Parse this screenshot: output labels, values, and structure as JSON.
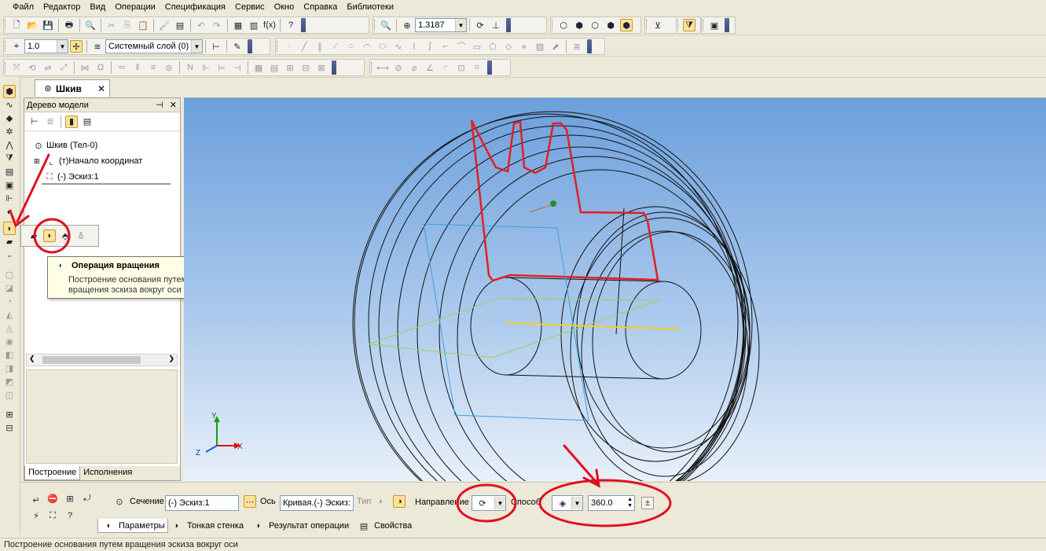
{
  "menu": [
    "Файл",
    "Редактор",
    "Вид",
    "Операции",
    "Спецификация",
    "Сервис",
    "Окно",
    "Справка",
    "Библиотеки"
  ],
  "toolbar": {
    "zoom_value": "1.3187",
    "line_width": "1.0",
    "layer": "Системный слой (0)"
  },
  "document_tab": {
    "title": "Шкив"
  },
  "tree": {
    "title": "Дерево модели",
    "root": "Шкив (Тел-0)",
    "items": [
      "(т)Начало координат",
      "(-) Эскиз:1"
    ],
    "tabs": [
      "Построение",
      "Исполнения"
    ]
  },
  "tooltip": {
    "title": "Операция вращения",
    "description": "Построение основания путем вращения эскиза вокруг оси"
  },
  "props": {
    "section_label": "Сечение",
    "section_value": "(-) Эскиз:1",
    "axis_label": "Ось",
    "axis_value": "Кривая.(-) Эскиз:",
    "type_label": "Тип",
    "direction_label": "Направление",
    "method_label": "Способ",
    "angle_value": "360.0",
    "tabs": [
      "Параметры",
      "Тонкая стенка",
      "Результат операции",
      "Свойства"
    ]
  },
  "axes": {
    "x": "X",
    "y": "Y",
    "z": "Z"
  },
  "status_text": "Построение основания путем вращения эскиза вокруг оси",
  "colors": {
    "viewport_top": "#6c9fdc",
    "sketch": "#e02020",
    "annotation": "#e01020",
    "axis_x": "#e01010",
    "axis_y": "#10a010",
    "axis_z": "#1060e0"
  }
}
